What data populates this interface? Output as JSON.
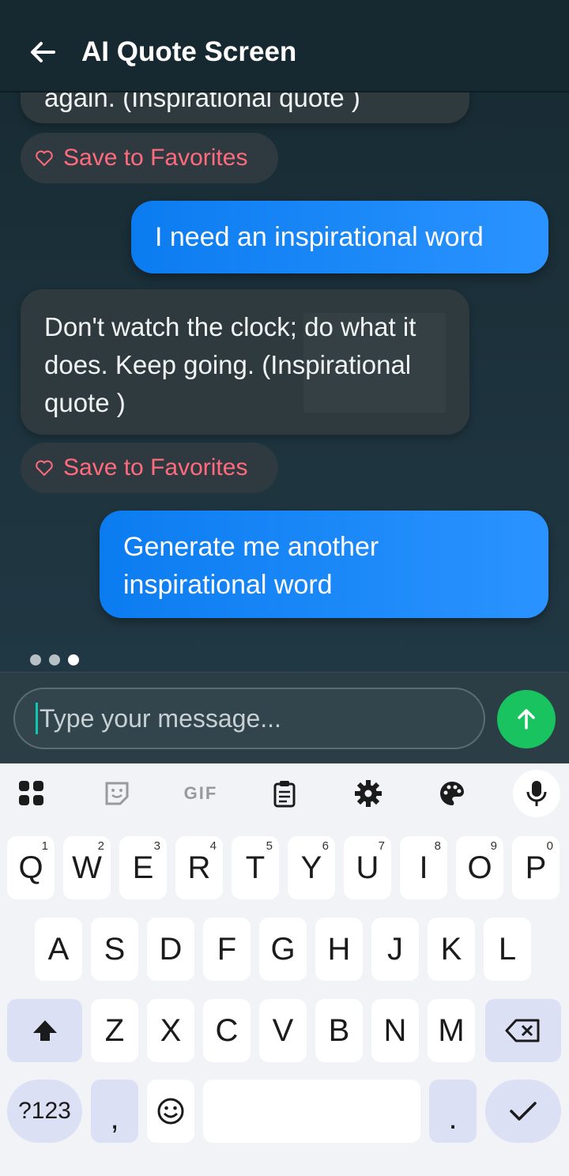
{
  "app": {
    "title": "AI Quote Screen"
  },
  "messages": {
    "ai_partial": "again. (Inspirational quote )",
    "fav_label": "Save to Favorites",
    "user_1": "I need an inspirational word",
    "ai_1": "Don't watch the clock; do what it does. Keep going. (Inspirational quote )",
    "user_2": "Generate me another inspirational word"
  },
  "composer": {
    "placeholder": "Type your message..."
  },
  "keyboard": {
    "row1": [
      {
        "k": "Q",
        "h": "1"
      },
      {
        "k": "W",
        "h": "2"
      },
      {
        "k": "E",
        "h": "3"
      },
      {
        "k": "R",
        "h": "4"
      },
      {
        "k": "T",
        "h": "5"
      },
      {
        "k": "Y",
        "h": "6"
      },
      {
        "k": "U",
        "h": "7"
      },
      {
        "k": "I",
        "h": "8"
      },
      {
        "k": "O",
        "h": "9"
      },
      {
        "k": "P",
        "h": "0"
      }
    ],
    "row2": [
      "A",
      "S",
      "D",
      "F",
      "G",
      "H",
      "J",
      "K",
      "L"
    ],
    "row3": [
      "Z",
      "X",
      "C",
      "V",
      "B",
      "N",
      "M"
    ],
    "symbols": "?123",
    "comma": ",",
    "period": ".",
    "gif": "GIF"
  },
  "colors": {
    "user_bubble": "#0b7cf0",
    "favorite": "#ff6b7d",
    "send": "#19c35f"
  }
}
